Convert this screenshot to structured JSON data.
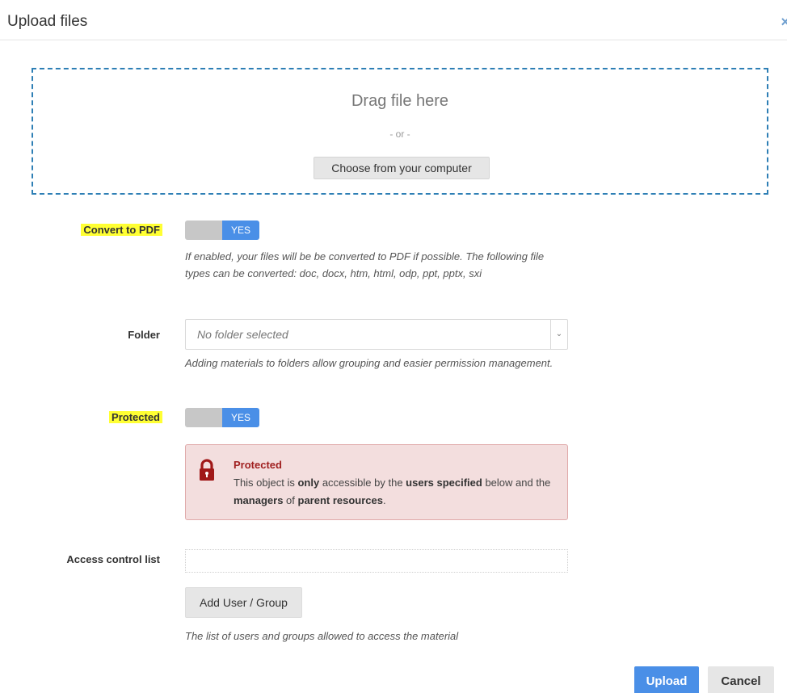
{
  "dialog": {
    "title": "Upload files",
    "close_icon": "close-icon"
  },
  "dropzone": {
    "drag_text": "Drag file here",
    "or_text": "- or -",
    "choose_label": "Choose from your computer"
  },
  "convert_pdf": {
    "label": "Convert to PDF",
    "toggle_value": "YES",
    "help": "If enabled, your files will be be converted to PDF if possible. The following file types can be converted: doc, docx, htm, html, odp, ppt, pptx, sxi"
  },
  "folder": {
    "label": "Folder",
    "placeholder": "No folder selected",
    "help": "Adding materials to folders allow grouping and easier permission management."
  },
  "protected": {
    "label": "Protected",
    "toggle_value": "YES",
    "alert": {
      "icon": "lock-icon",
      "title": "Protected",
      "body_1": "This object is ",
      "body_only": "only",
      "body_2": " accessible by the ",
      "body_users": "users specified",
      "body_3": " below and the ",
      "body_managers": "managers",
      "body_4": " of ",
      "body_parent": "parent resources",
      "body_5": "."
    }
  },
  "acl": {
    "label": "Access control list",
    "add_label": "Add User / Group",
    "help": "The list of users and groups allowed to access the material"
  },
  "footer": {
    "upload_label": "Upload",
    "cancel_label": "Cancel"
  },
  "colors": {
    "primary": "#4a8fe7",
    "highlight": "#ffff33",
    "danger_text": "#a02020",
    "danger_bg": "#f3dede",
    "dropzone_border": "#2e7fb5"
  }
}
